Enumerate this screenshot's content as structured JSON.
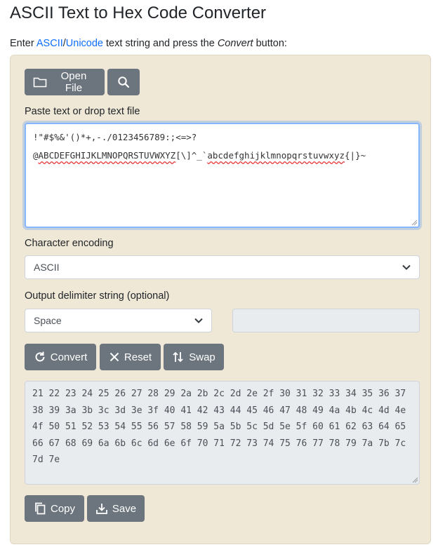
{
  "page": {
    "title": "ASCII Text to Hex Code Converter",
    "intro_prefix": "Enter ",
    "intro_link_ascii": "ASCII",
    "intro_slash": "/",
    "intro_link_unicode": "Unicode",
    "intro_mid": " text string and press the ",
    "intro_convert": "Convert",
    "intro_suffix": " button:"
  },
  "toolbar": {
    "open_file_label": "Open File",
    "search_icon": "search-icon",
    "folder_icon": "folder-icon"
  },
  "input": {
    "label": "Paste text or drop text file",
    "line1": "!\"#$%&'()*+,-./0123456789:;<=>?",
    "line2_a": "@",
    "line2_b": "ABCDEFGHIJKLMNOPQRSTUVWXYZ",
    "line2_c": "[\\]^_`",
    "line2_d": "abcdefghijklmnopqrstuvwxyz",
    "line2_e": "{|}~"
  },
  "encoding": {
    "label": "Character encoding",
    "selected": "ASCII"
  },
  "delimiter": {
    "label": "Output delimiter string (optional)",
    "selected": "Space"
  },
  "actions": {
    "convert_label": "Convert",
    "reset_label": "Reset",
    "swap_label": "Swap"
  },
  "output": {
    "text": "21 22 23 24 25 26 27 28 29 2a 2b 2c 2d 2e 2f 30 31 32 33 34 35 36 37 38 39 3a 3b 3c 3d 3e 3f 40 41 42 43 44 45 46 47 48 49 4a 4b 4c 4d 4e 4f 50 51 52 53 54 55 56 57 58 59 5a 5b 5c 5d 5e 5f 60 61 62 63 64 65 66 67 68 69 6a 6b 6c 6d 6e 6f 70 71 72 73 74 75 76 77 78 79 7a 7b 7c 7d 7e"
  },
  "footer": {
    "copy_label": "Copy",
    "save_label": "Save"
  },
  "colors": {
    "panel": "#efe8d6",
    "button": "#6c757d",
    "link": "#0d6efd",
    "focus": "#86b7fe"
  }
}
